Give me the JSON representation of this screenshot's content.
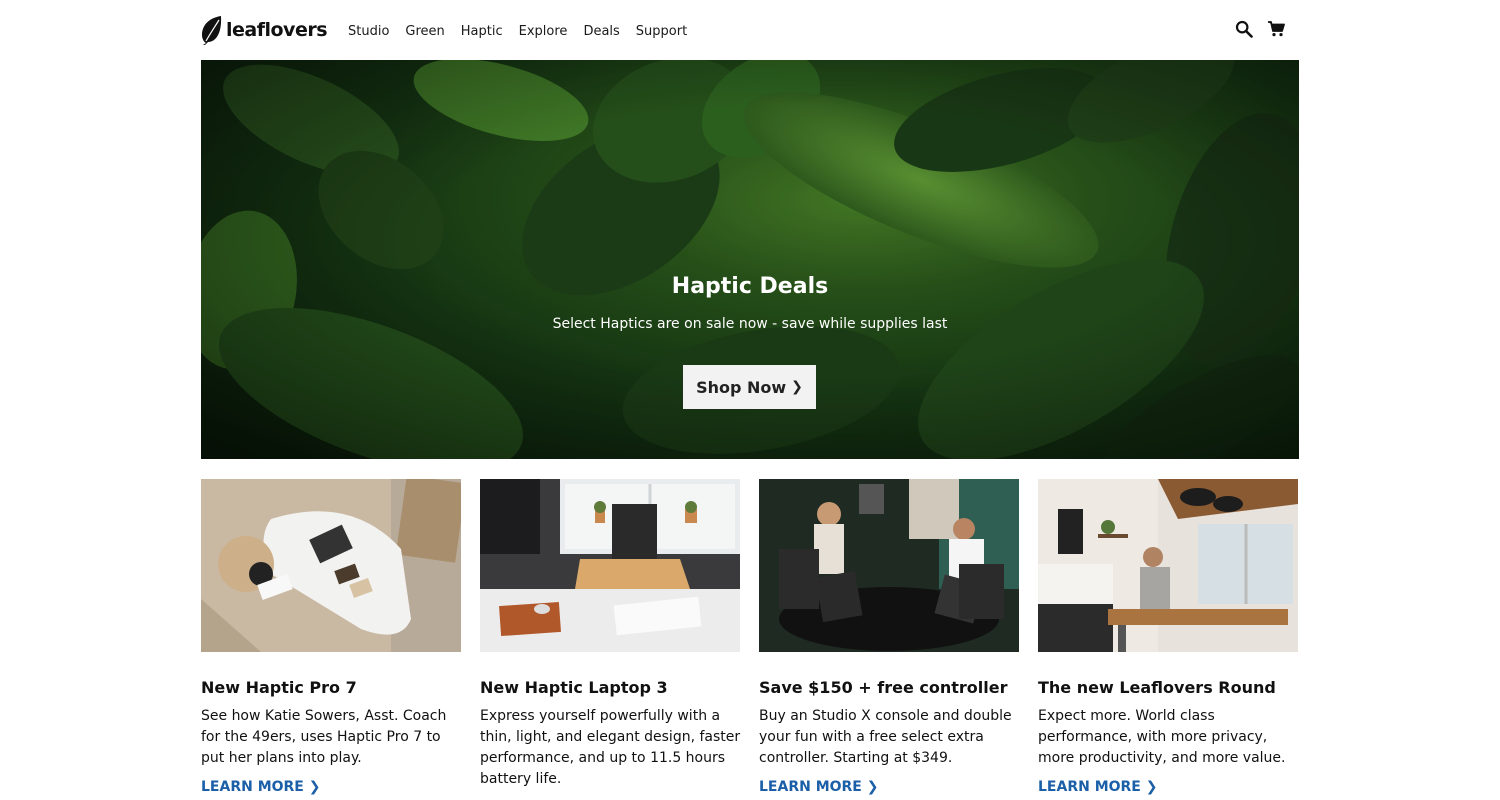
{
  "brand": {
    "name": "leaflovers"
  },
  "nav": {
    "items": [
      "Studio",
      "Green",
      "Haptic",
      "Explore",
      "Deals",
      "Support"
    ]
  },
  "header_icons": [
    "search-icon",
    "cart-icon"
  ],
  "hero": {
    "title": "Haptic Deals",
    "subtitle": "Select Haptics are on sale now - save while supplies last",
    "button_label": "Shop Now"
  },
  "cards": [
    {
      "title": "New Haptic Pro 7",
      "description": "See how Katie Sowers, Asst. Coach for the 49ers, uses Haptic Pro 7 to put her plans into play.",
      "link": "LEARN MORE"
    },
    {
      "title": "New Haptic Laptop 3",
      "description": "Express yourself powerfully with a thin, light, and elegant design, faster performance, and up to 11.5 hours battery life.",
      "link": ""
    },
    {
      "title": "Save $150 + free controller",
      "description": "Buy an Studio X console and double your fun with a free select extra controller. Starting at $349.",
      "link": "LEARN MORE"
    },
    {
      "title": "The new Leaflovers Round",
      "description": "Expect more. World class performance, with more privacy, more productivity, and more value.",
      "link": "LEARN MORE"
    }
  ],
  "colors": {
    "link": "#1b5fa8",
    "hero_button_bg": "#f2f2f2",
    "hero_overlay": "#1c3d16"
  }
}
